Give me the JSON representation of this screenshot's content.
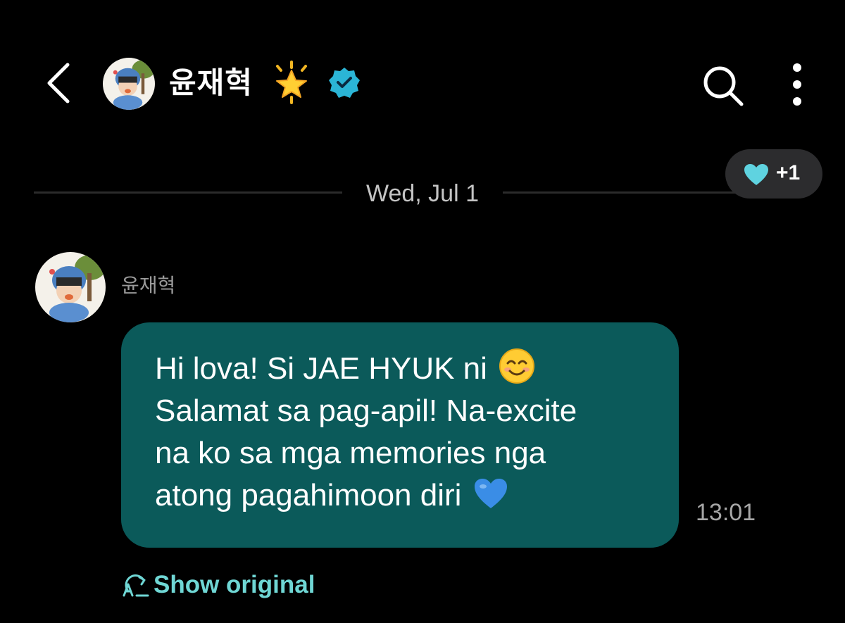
{
  "header": {
    "back_icon": "chevron-left-icon",
    "contact_name": "윤재혁",
    "star_icon": "glowing-star-icon",
    "verified_icon": "verified-badge-icon",
    "search_icon": "search-icon",
    "more_icon": "more-vertical-icon"
  },
  "conversation": {
    "date_divider": "Wed, Jul 1",
    "reaction": {
      "icon": "light-blue-heart-icon",
      "count": "+1"
    },
    "messages": [
      {
        "sender": "윤재혁",
        "lines": [
          "Hi lova! Si JAE HYUK ni",
          "Salamat sa pag-apil! Na-excite",
          "na ko sa mga memories nga",
          "atong pagahimoon diri"
        ],
        "inline_emojis": [
          "smiling-face-icon",
          "blue-heart-icon"
        ],
        "time": "13:01",
        "show_original_label": "Show original",
        "show_original_icon": "translate-icon"
      }
    ]
  },
  "colors": {
    "background": "#000000",
    "bubble": "#0b5a5a",
    "accent": "#6fd6d4",
    "verified": "#2bb5d6",
    "muted_text": "#9a9a9a"
  }
}
